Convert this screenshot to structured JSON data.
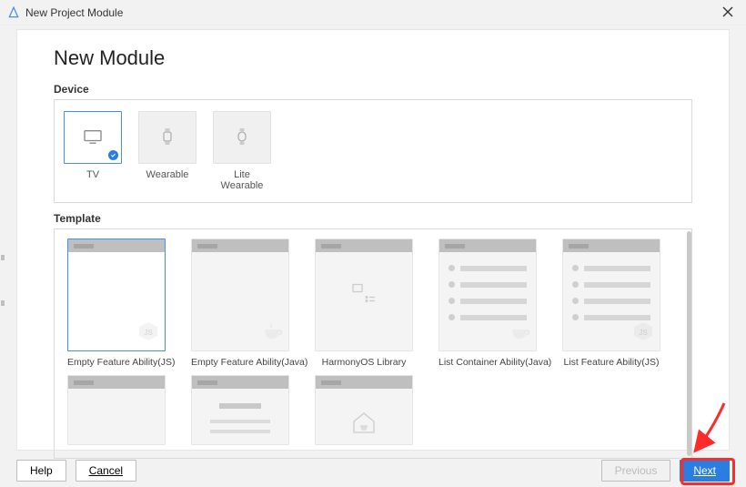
{
  "window": {
    "title": "New Project Module"
  },
  "heading": "New Module",
  "sections": {
    "device_label": "Device",
    "template_label": "Template"
  },
  "devices": [
    {
      "id": "tv",
      "label": "TV",
      "selected": true
    },
    {
      "id": "wearable",
      "label": "Wearable",
      "selected": false
    },
    {
      "id": "lite-wearable",
      "label": "Lite Wearable",
      "selected": false
    }
  ],
  "templates_row1": [
    {
      "id": "empty-js",
      "label": "Empty Feature Ability(JS)",
      "corner": "js",
      "selected": true
    },
    {
      "id": "empty-java",
      "label": "Empty Feature Ability(Java)",
      "corner": "java",
      "selected": false
    },
    {
      "id": "harmony-lib",
      "label": "HarmonyOS Library",
      "corner": "lib",
      "selected": false
    },
    {
      "id": "list-java",
      "label": "List Container Ability(Java)",
      "corner": "java",
      "list": true,
      "selected": false
    },
    {
      "id": "list-js",
      "label": "List Feature Ability(JS)",
      "corner": "js",
      "list": true,
      "selected": false
    }
  ],
  "templates_row2": [
    {
      "id": "r2a"
    },
    {
      "id": "r2b",
      "lines": true
    },
    {
      "id": "r2c",
      "house": true
    }
  ],
  "buttons": {
    "help": "Help",
    "cancel": "Cancel",
    "previous": "Previous",
    "next": "Next"
  }
}
